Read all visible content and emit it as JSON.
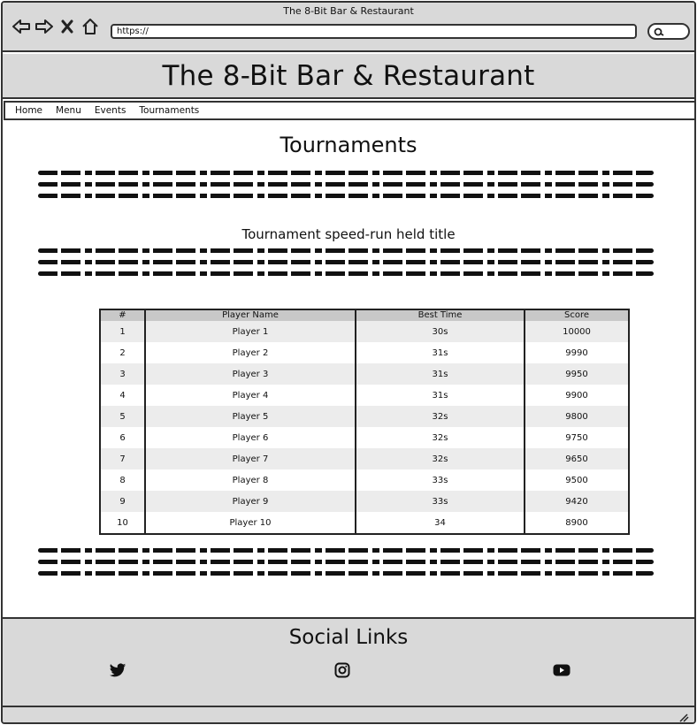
{
  "window": {
    "title": "The 8-Bit Bar & Restaurant"
  },
  "browser": {
    "url": "https://"
  },
  "header": {
    "title": "The 8-Bit Bar & Restaurant"
  },
  "nav": {
    "items": [
      "Home",
      "Menu",
      "Events",
      "Tournaments"
    ]
  },
  "main": {
    "heading": "Tournaments",
    "subheading": "Tournament speed-run held title"
  },
  "table": {
    "headers": [
      "#",
      "Player Name",
      "Best Time",
      "Score"
    ],
    "rows": [
      [
        "1",
        "Player 1",
        "30s",
        "10000"
      ],
      [
        "2",
        "Player 2",
        "31s",
        "9990"
      ],
      [
        "3",
        "Player 3",
        "31s",
        "9950"
      ],
      [
        "4",
        "Player 4",
        "31s",
        "9900"
      ],
      [
        "5",
        "Player 5",
        "32s",
        "9800"
      ],
      [
        "6",
        "Player 6",
        "32s",
        "9750"
      ],
      [
        "7",
        "Player 7",
        "32s",
        "9650"
      ],
      [
        "8",
        "Player 8",
        "33s",
        "9500"
      ],
      [
        "9",
        "Player 9",
        "33s",
        "9420"
      ],
      [
        "10",
        "Player 10",
        "34",
        "8900"
      ]
    ]
  },
  "footer": {
    "title": "Social Links",
    "icons": [
      "twitter-icon",
      "instagram-icon",
      "youtube-icon"
    ]
  },
  "colors": {
    "chrome": "#d9d9d9",
    "stripe": "#ececec",
    "table_header": "#c8c8c8"
  }
}
